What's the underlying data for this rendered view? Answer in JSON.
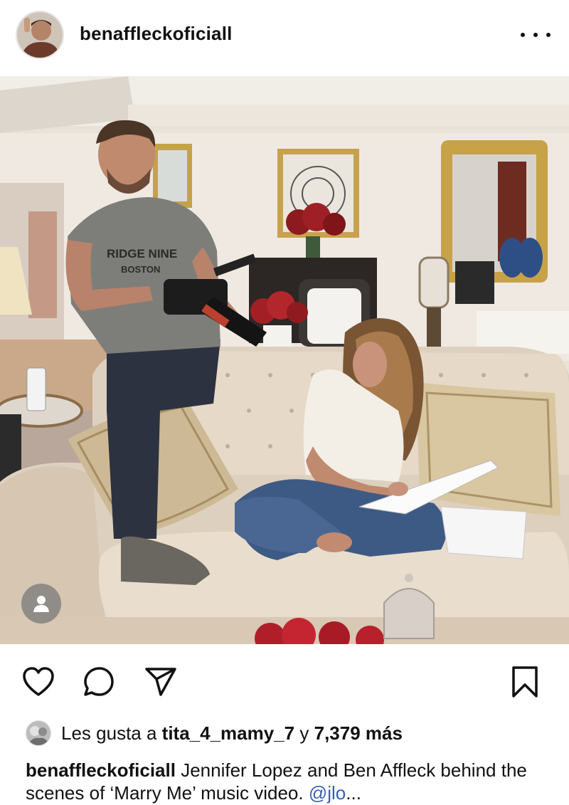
{
  "header": {
    "username": "benaffleckoficiall",
    "more_label": "•••"
  },
  "photo": {
    "shirt_text_1": "RIDGE NINE",
    "shirt_text_2": "BOSTON"
  },
  "icons": {
    "like": "heart-icon",
    "comment": "comment-icon",
    "share": "send-icon",
    "save": "bookmark-icon",
    "tag": "person-icon"
  },
  "likes": {
    "prefix": "Les gusta a",
    "user": "tita_4_mamy_7",
    "joiner": "y",
    "count": "7,379 más"
  },
  "caption": {
    "username": "benaffleckoficiall",
    "text": "Jennifer Lopez and Ben Affleck behind the scenes of ‘Marry Me’ music video.",
    "mention": "@jlo",
    "ellipsis": "..."
  },
  "colors": {
    "link": "#3a5fb0",
    "text": "#111111"
  }
}
